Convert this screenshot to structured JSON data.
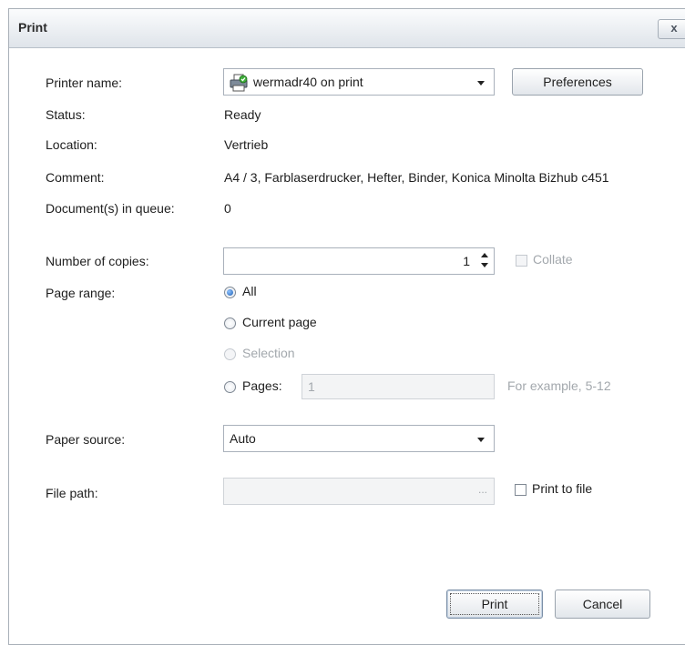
{
  "dialog": {
    "title": "Print",
    "close_label": "x"
  },
  "printer": {
    "name_label": "Printer name:",
    "selected": "wermadr40 on print",
    "preferences_label": "Preferences",
    "status_label": "Status:",
    "status_value": "Ready",
    "location_label": "Location:",
    "location_value": "Vertrieb",
    "comment_label": "Comment:",
    "comment_value": "A4 / 3, Farblaserdrucker, Hefter, Binder, Konica Minolta Bizhub c451",
    "queue_label": "Document(s) in queue:",
    "queue_value": "0"
  },
  "copies": {
    "label": "Number of copies:",
    "value": "1",
    "collate_label": "Collate"
  },
  "page_range": {
    "label": "Page range:",
    "options": [
      {
        "label": "All",
        "checked": true,
        "disabled": false
      },
      {
        "label": "Current page",
        "checked": false,
        "disabled": false
      },
      {
        "label": "Selection",
        "checked": false,
        "disabled": true
      },
      {
        "label": "Pages:",
        "checked": false,
        "disabled": false
      }
    ],
    "pages_value": "1",
    "example_text": "For example, 5-12"
  },
  "paper_source": {
    "label": "Paper source:",
    "selected": "Auto"
  },
  "file_path": {
    "label": "File path:",
    "value": "",
    "browse_label": "...",
    "print_to_file_label": "Print to file"
  },
  "actions": {
    "print_label": "Print",
    "cancel_label": "Cancel"
  },
  "colors": {
    "title_bar_top": "#fbfcfd",
    "title_bar_bottom": "#dfe4ea",
    "radio_checked": "#1e5fb3",
    "disabled_text": "#a3a8ad"
  }
}
